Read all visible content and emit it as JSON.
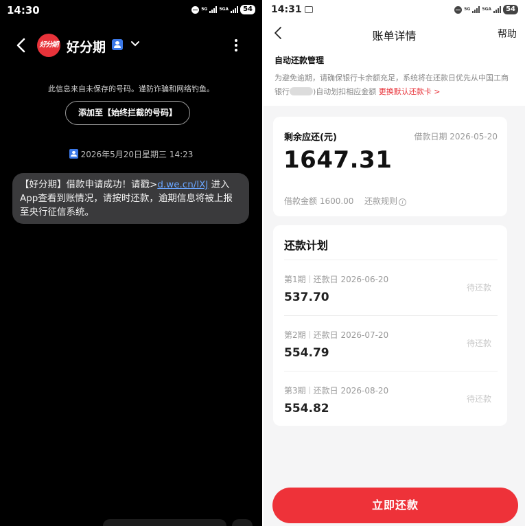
{
  "left": {
    "status_bar": {
      "time": "14:30",
      "network_1": "5G",
      "network_2": "5GA",
      "battery": "54"
    },
    "header": {
      "logo_text": "好分期",
      "title": "好分期"
    },
    "notice": "此信息来自未保存的号码。谨防诈骗和网络钓鱼。",
    "add_button": "添加至【始终拦截的号码】",
    "datetime": "2026年5月20日星期三 14:23",
    "message": {
      "before_link": "【好分期】借款申请成功！请戳>",
      "link": "d.we.cn/lXJ",
      "after_link": " 进入App查看到账情况，请按时还款，逾期信息将被上报至央行征信系统。"
    }
  },
  "right": {
    "status_bar": {
      "time": "14:31",
      "network_1": "5G",
      "network_2": "5GA",
      "battery": "54"
    },
    "header": {
      "title": "账单详情",
      "help": "帮助"
    },
    "auto_repay": {
      "title": "自动还款管理",
      "text_1": "为避免逾期，请确保银行卡余额充足，系统将在还款日优先从中国工商银行",
      "text_2": ")自动划扣相应金额",
      "link": "更换默认还款卡 >"
    },
    "summary": {
      "remaining_label": "剩余应还(元)",
      "loan_date": "借款日期 2026-05-20",
      "amount": "1647.31",
      "loan_amount": "借款金额 1600.00",
      "rules": "还款规则",
      "info_icon": "i"
    },
    "plan": {
      "title": "还款计划",
      "rows": [
        {
          "period": "第1期",
          "due": "还款日 2026-06-20",
          "amount": "537.70",
          "status": "待还款"
        },
        {
          "period": "第2期",
          "due": "还款日 2026-07-20",
          "amount": "554.79",
          "status": "待还款"
        },
        {
          "period": "第3期",
          "due": "还款日 2026-08-20",
          "amount": "554.82",
          "status": "待还款"
        }
      ]
    },
    "pay_button": "立即还款"
  },
  "colors": {
    "accent_red": "#ee3239",
    "link_blue": "#6aa6ff",
    "bubble_bg": "#3a3a3c"
  }
}
